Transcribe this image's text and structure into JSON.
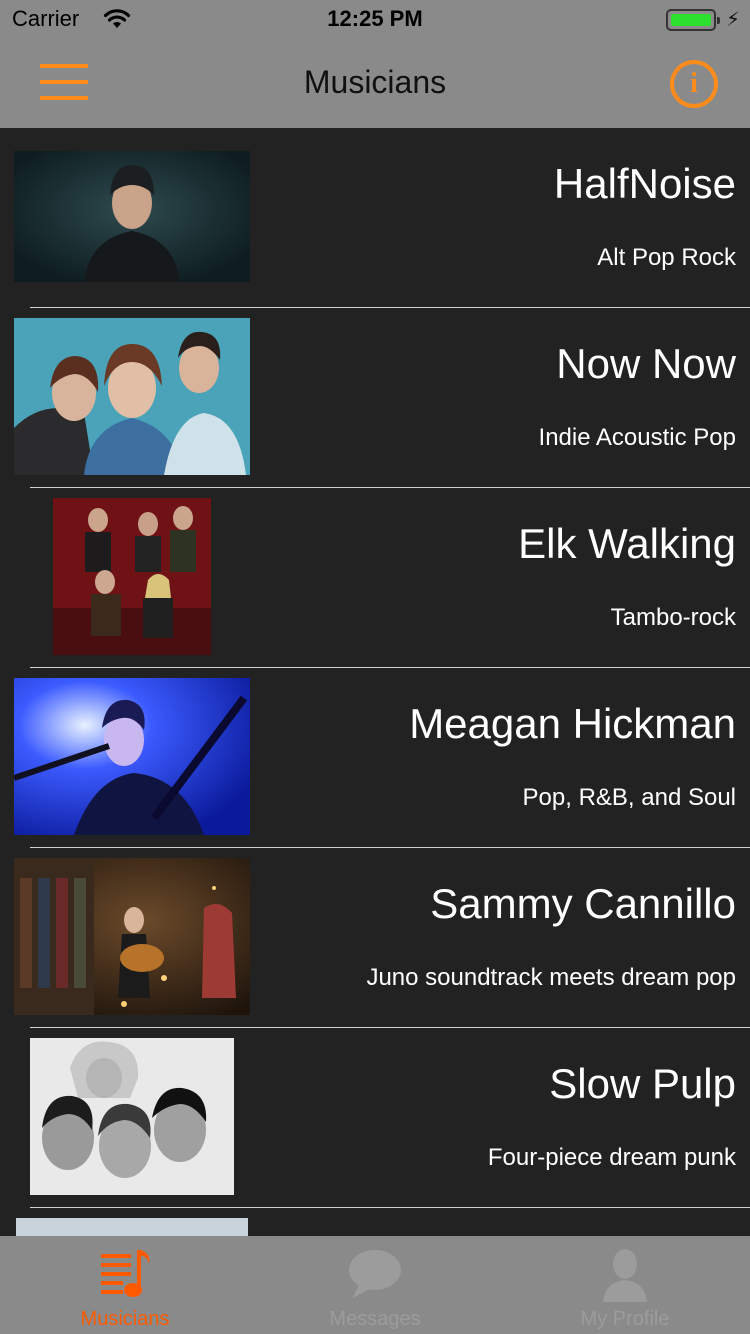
{
  "status_bar": {
    "carrier": "Carrier",
    "time": "12:25 PM",
    "battery_color": "#2ee02e"
  },
  "nav_bar": {
    "title": "Musicians",
    "menu_icon": "hamburger-menu-icon",
    "info_icon": "info-circle-icon",
    "info_glyph": "i",
    "accent_color": "#ff8c1a"
  },
  "musicians": [
    {
      "name": "HalfNoise",
      "genre": "Alt Pop Rock"
    },
    {
      "name": "Now Now",
      "genre": "Indie Acoustic Pop"
    },
    {
      "name": "Elk Walking",
      "genre": "Tambo-rock"
    },
    {
      "name": "Meagan Hickman",
      "genre": "Pop, R&B, and Soul"
    },
    {
      "name": "Sammy Cannillo",
      "genre": "Juno soundtrack meets dream pop"
    },
    {
      "name": "Slow Pulp",
      "genre": "Four-piece dream punk"
    }
  ],
  "tab_bar": {
    "tabs": [
      {
        "label": "Musicians",
        "icon": "music-list-icon",
        "active": true
      },
      {
        "label": "Messages",
        "icon": "chat-bubble-icon",
        "active": false
      },
      {
        "label": "My Profile",
        "icon": "person-icon",
        "active": false
      }
    ],
    "active_color": "#ff5a00",
    "inactive_color": "#9c9c9c"
  }
}
